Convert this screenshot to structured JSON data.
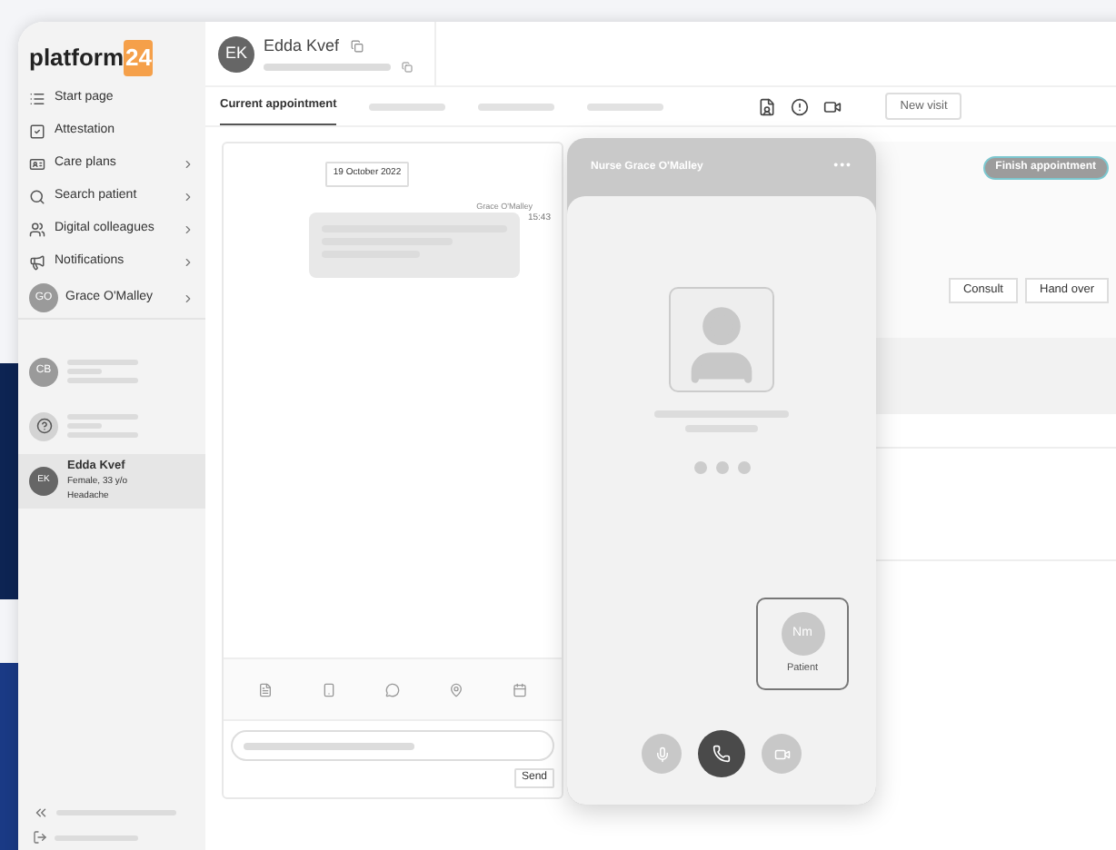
{
  "brand": {
    "name": "platform",
    "badge": "24"
  },
  "nav": [
    {
      "label": "Start page",
      "has_submenu": false
    },
    {
      "label": "Attestation",
      "has_submenu": false
    },
    {
      "label": "Care plans",
      "has_submenu": true
    },
    {
      "label": "Search patient",
      "has_submenu": true
    },
    {
      "label": "Digital colleagues",
      "has_submenu": true
    },
    {
      "label": "Notifications",
      "has_submenu": true
    }
  ],
  "user": {
    "initials": "GO",
    "name": "Grace O'Malley",
    "has_submenu": true
  },
  "queue": [
    {
      "kind": "initials",
      "initials": "CB",
      "selected": false
    },
    {
      "kind": "icon",
      "selected": false
    },
    {
      "kind": "patient",
      "initials": "EK",
      "name": "Edda Kvef",
      "details": "Female, 33 y/o",
      "complaint": "Headache",
      "selected": true
    }
  ],
  "patient_header": {
    "initials": "EK",
    "name": "Edda Kvef"
  },
  "tabs": [
    {
      "kind": "label",
      "label": "Current appointment",
      "selected": true
    },
    {
      "kind": "skeleton",
      "selected": false
    },
    {
      "kind": "skeleton",
      "selected": false
    },
    {
      "kind": "skeleton",
      "selected": false
    }
  ],
  "new_visit": "New visit",
  "chat": {
    "date": "19 October 2022",
    "sender": "Grace O'Malley",
    "time": "15:43",
    "send": "Send"
  },
  "appointment": {
    "finish": "Finish appointment",
    "actions": [
      "Consult",
      "Hand over"
    ]
  },
  "call": {
    "title": "Nurse Grace O'Malley",
    "menu": "•••",
    "patient_initials": "Nm",
    "patient_label": "Patient"
  }
}
